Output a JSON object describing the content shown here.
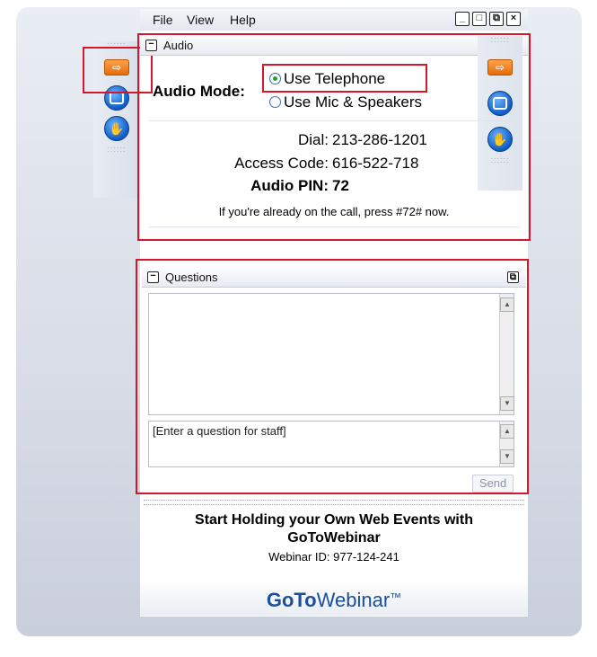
{
  "menu": {
    "file": "File",
    "view": "View",
    "help": "Help"
  },
  "window_buttons": {
    "minimize": "_",
    "maximize": "□",
    "restore": "⧉",
    "close": "×"
  },
  "audio": {
    "section_title": "Audio",
    "collapse_symbol": "−",
    "mode_label": "Audio Mode:",
    "option_telephone": "Use Telephone",
    "option_mic": "Use Mic & Speakers",
    "selected_option": "Use Telephone",
    "dial_label": "Dial:",
    "dial_value": "213-286-1201",
    "access_label": "Access Code:",
    "access_value": "616-522-718",
    "pin_label": "Audio PIN:",
    "pin_value": "72",
    "note": "If you're already on the call, press #72# now."
  },
  "questions": {
    "section_title": "Questions",
    "collapse_symbol": "−",
    "popout_symbol": "⧉",
    "input_placeholder": "[Enter a question for staff]",
    "send_label": "Send"
  },
  "promo": {
    "line1": "Start Holding your Own Web Events with",
    "line2": "GoToWebinar",
    "webinar_id": "Webinar ID: 977-124-241"
  },
  "footer": {
    "brand_bold": "GoTo",
    "brand_light": "Webinar",
    "tm": "™"
  },
  "colors": {
    "highlight_red": "#d4172b",
    "brand_blue": "#1b4f9c",
    "accent_orange": "#e46d0b"
  },
  "icons": [
    "arrow-right-icon",
    "stop-icon",
    "raise-hand-icon"
  ]
}
